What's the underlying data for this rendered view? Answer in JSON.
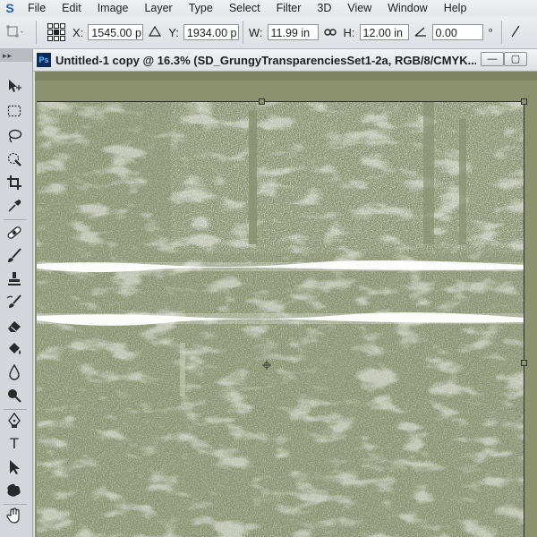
{
  "app": {
    "logo_letter": "S",
    "menu": [
      "File",
      "Edit",
      "Image",
      "Layer",
      "Type",
      "Select",
      "Filter",
      "3D",
      "View",
      "Window",
      "Help"
    ]
  },
  "options": {
    "x_label": "X:",
    "x_value": "1545.00 p",
    "y_label": "Y:",
    "y_value": "1934.00 p",
    "w_label": "W:",
    "w_value": "11.99 in",
    "h_label": "H:",
    "h_value": "12.00 in",
    "angle_value": "0.00",
    "degree_symbol": "°"
  },
  "tools_panel": {
    "grip": "▸▸",
    "tools": [
      "move",
      "marquee",
      "lasso",
      "quick-select",
      "crop",
      "eyedropper",
      "healing-brush",
      "brush",
      "clone-stamp",
      "history-brush",
      "eraser",
      "paint-bucket",
      "blur",
      "dodge",
      "pen",
      "type",
      "path-select",
      "shape",
      "hand"
    ],
    "type_glyph": "T"
  },
  "document": {
    "ps_badge": "Ps",
    "title": "Untitled-1 copy @ 16.3% (SD_GrungyTransparenciesSet1-2a, RGB/8/CMYK...",
    "minimize": "—",
    "restore": "▢"
  },
  "colors": {
    "canvas": "#8a9270",
    "texture_white": "#ffffff"
  }
}
